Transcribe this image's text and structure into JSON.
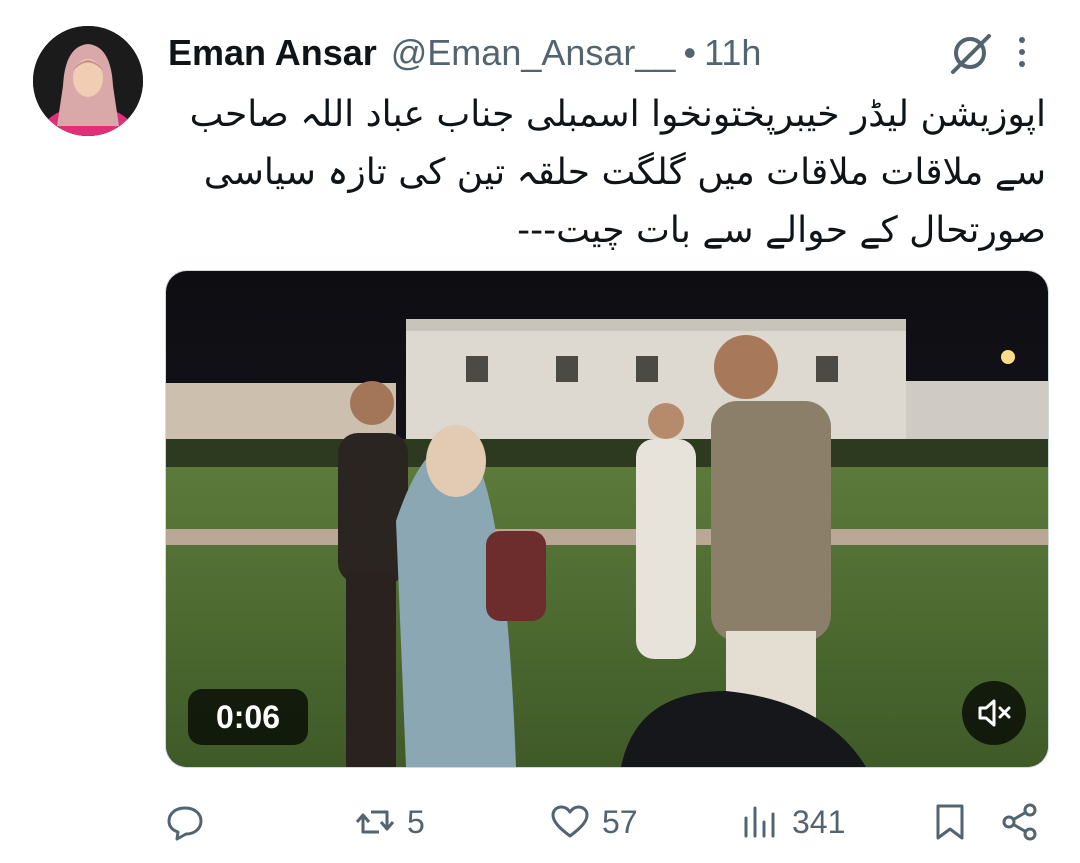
{
  "author": {
    "name": "Eman Ansar",
    "handle": "@Eman_Ansar__",
    "separator": "•",
    "time": "11h"
  },
  "tweet": {
    "text": "اپوزیشن لیڈر خیبرپختونخوا اسمبلی جناب عباد اللہ صاحب سے ملاقات ملاقات میں گلگت حلقہ تین کی تازہ سیاسی صورتحال کے حوالے سے بات چیت---"
  },
  "video": {
    "duration": "0:06"
  },
  "actions": {
    "replies": "",
    "retweets": "5",
    "likes": "57",
    "views": "341"
  },
  "icons": {
    "header": [
      "grok-icon",
      "more-icon"
    ],
    "video": [
      "volume-muted-icon"
    ],
    "actions": [
      "reply-icon",
      "retweet-icon",
      "like-icon",
      "views-icon",
      "bookmark-icon",
      "share-icon"
    ]
  },
  "colors": {
    "text": "#0f1419",
    "secondary": "#536471",
    "background": "#ffffff"
  }
}
